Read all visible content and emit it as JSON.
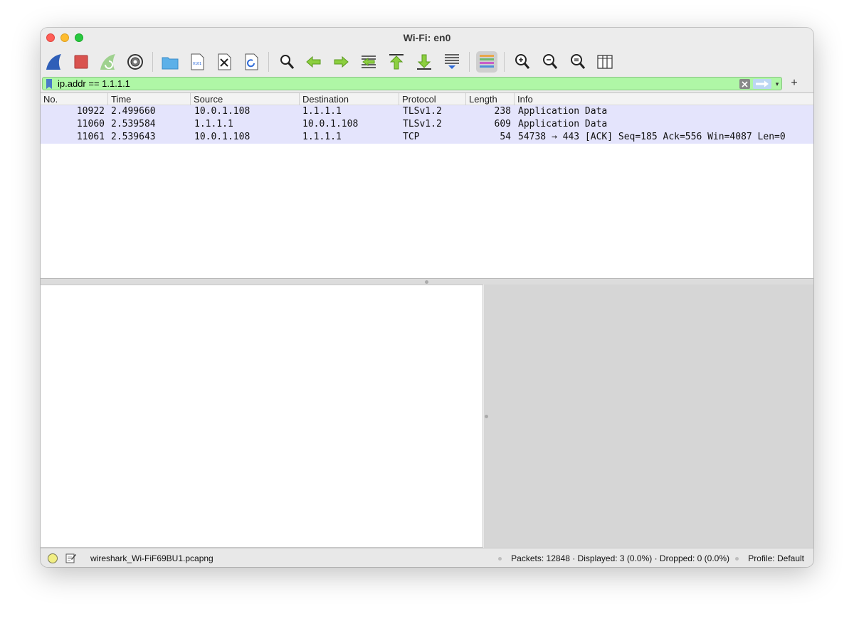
{
  "window": {
    "title": "Wi-Fi: en0"
  },
  "filter": {
    "value": "ip.addr == 1.1.1.1"
  },
  "packet_list": {
    "columns": [
      "No.",
      "Time",
      "Source",
      "Destination",
      "Protocol",
      "Length",
      "Info"
    ],
    "rows": [
      {
        "no": "10922",
        "time": "2.499660",
        "source": "10.0.1.108",
        "destination": "1.1.1.1",
        "protocol": "TLSv1.2",
        "length": "238",
        "info": "Application Data"
      },
      {
        "no": "11060",
        "time": "2.539584",
        "source": "1.1.1.1",
        "destination": "10.0.1.108",
        "protocol": "TLSv1.2",
        "length": "609",
        "info": "Application Data"
      },
      {
        "no": "11061",
        "time": "2.539643",
        "source": "10.0.1.108",
        "destination": "1.1.1.1",
        "protocol": "TCP",
        "length": "54",
        "info": "54738 → 443 [ACK] Seq=185 Ack=556 Win=4087 Len=0"
      }
    ],
    "row_color": "#e4e4fc"
  },
  "statusbar": {
    "file": "wireshark_Wi-FiF69BU1.pcapng",
    "stats": "Packets: 12848 · Displayed: 3 (0.0%) · Dropped: 0 (0.0%)",
    "profile": "Profile: Default"
  },
  "toolbar": {
    "icons": [
      "shark-fin-start-icon",
      "stop-capture-icon",
      "restart-capture-icon",
      "capture-options-gear-icon",
      "open-folder-icon",
      "save-file-icon",
      "close-file-icon",
      "reload-file-icon",
      "find-packet-icon",
      "go-back-icon",
      "go-forward-icon",
      "go-to-packet-icon",
      "go-first-icon",
      "go-last-icon",
      "autoscroll-icon",
      "colorize-icon",
      "zoom-in-icon",
      "zoom-out-icon",
      "normal-size-icon",
      "resize-columns-icon"
    ]
  },
  "colors": {
    "filter_valid": "#aff7a6",
    "accent": "#2f6bd8"
  }
}
